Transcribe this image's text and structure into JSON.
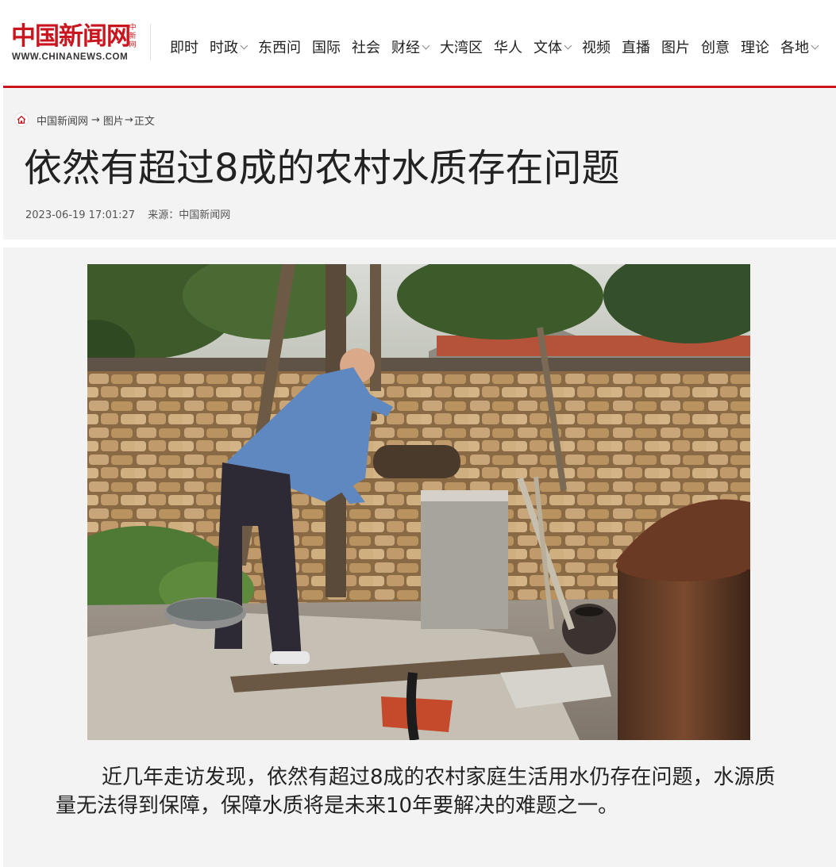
{
  "site": {
    "logo_cn": "中国新闻网",
    "logo_small": "中新网",
    "logo_en": "WWW.CHINANEWS.COM"
  },
  "nav": [
    {
      "label": "即时",
      "dropdown": false
    },
    {
      "label": "时政",
      "dropdown": true
    },
    {
      "label": "东西问",
      "dropdown": false
    },
    {
      "label": "国际",
      "dropdown": false
    },
    {
      "label": "社会",
      "dropdown": false
    },
    {
      "label": "财经",
      "dropdown": true
    },
    {
      "label": "大湾区",
      "dropdown": false
    },
    {
      "label": "华人",
      "dropdown": false
    },
    {
      "label": "文体",
      "dropdown": true
    },
    {
      "label": "视频",
      "dropdown": false
    },
    {
      "label": "直播",
      "dropdown": false
    },
    {
      "label": "图片",
      "dropdown": false
    },
    {
      "label": "创意",
      "dropdown": false
    },
    {
      "label": "理论",
      "dropdown": false
    },
    {
      "label": "各地",
      "dropdown": true
    }
  ],
  "breadcrumb": {
    "home": "中国新闻网",
    "sep1": "→",
    "section": "图片",
    "sep2": "→",
    "current": "正文"
  },
  "article": {
    "title": "依然有超过8成的农村水质存在问题",
    "datetime": "2023-06-19 17:01:27",
    "source": "来源：中国新闻网",
    "caption": "近几年走访发现，依然有超过8成的农村家庭生活用水仍存在问题，水源质量无法得到保障，保障水质将是未来10年要解决的难题之一。"
  },
  "colors": {
    "brand_red": "#c9151e",
    "panel_bg": "#f3f3f3"
  }
}
